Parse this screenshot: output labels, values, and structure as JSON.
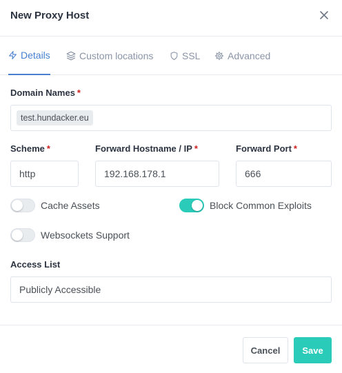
{
  "modal": {
    "title": "New Proxy Host"
  },
  "tabs": [
    {
      "label": "Details",
      "icon": "zap-icon",
      "active": true
    },
    {
      "label": "Custom locations",
      "icon": "layers-icon",
      "active": false
    },
    {
      "label": "SSL",
      "icon": "shield-icon",
      "active": false
    },
    {
      "label": "Advanced",
      "icon": "settings-icon",
      "active": false
    }
  ],
  "form": {
    "domain_names": {
      "label": "Domain Names",
      "required": "*",
      "chips": [
        "test.hundacker.eu"
      ]
    },
    "scheme": {
      "label": "Scheme",
      "required": "*",
      "value": "http"
    },
    "forward_host": {
      "label": "Forward Hostname / IP",
      "required": "*",
      "value": "192.168.178.1"
    },
    "forward_port": {
      "label": "Forward Port",
      "required": "*",
      "value": "666"
    },
    "cache_assets": {
      "label": "Cache Assets",
      "enabled": false
    },
    "block_exploits": {
      "label": "Block Common Exploits",
      "enabled": true
    },
    "websockets": {
      "label": "Websockets Support",
      "enabled": false
    },
    "access_list": {
      "label": "Access List",
      "value": "Publicly Accessible"
    }
  },
  "footer": {
    "cancel_label": "Cancel",
    "save_label": "Save"
  },
  "colors": {
    "accent": "#467fcf",
    "toggle_on": "#2bcbba",
    "required": "#cd201f",
    "save_button": "#2bcbba"
  }
}
